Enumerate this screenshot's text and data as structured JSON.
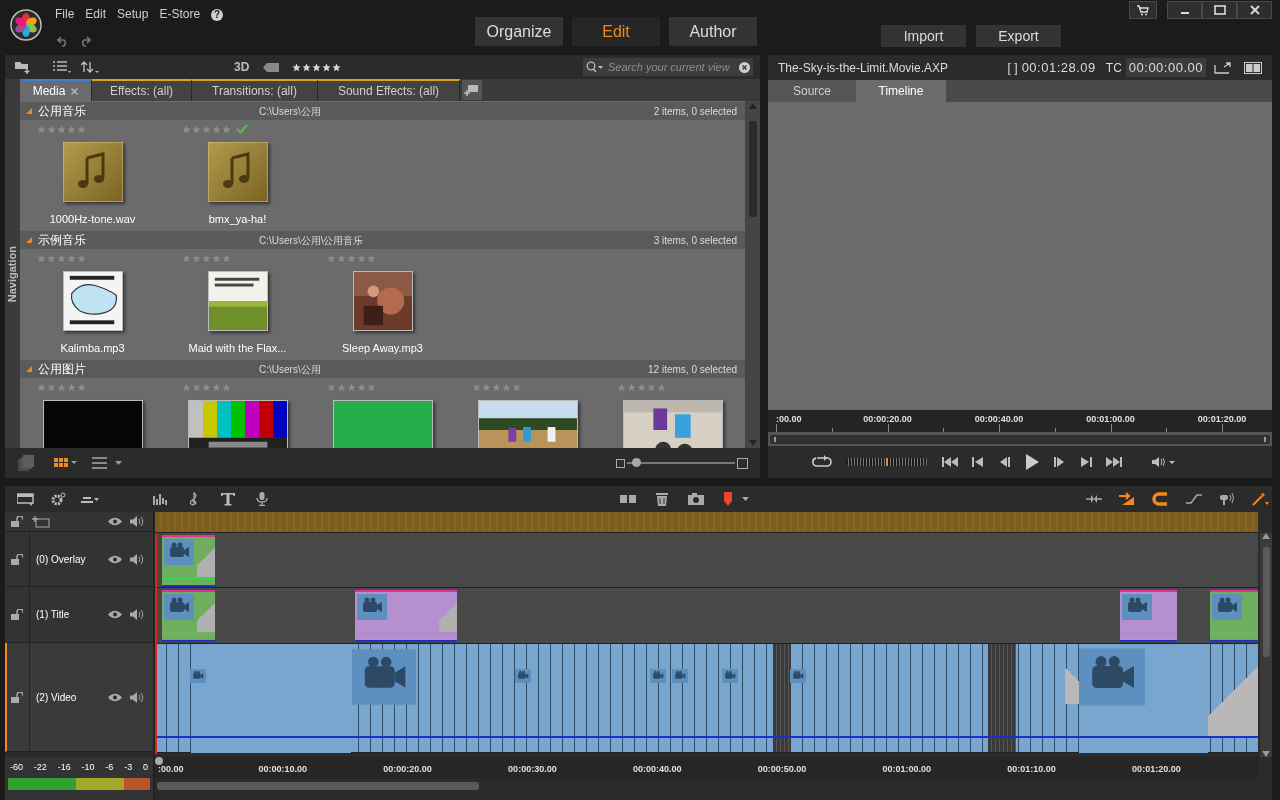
{
  "menu": [
    "File",
    "Edit",
    "Setup",
    "E-Store"
  ],
  "help": "?",
  "modes": [
    {
      "label": "Organize",
      "selected": false
    },
    {
      "label": "Edit",
      "selected": true
    },
    {
      "label": "Author",
      "selected": false
    }
  ],
  "actions": [
    "Import",
    "Export"
  ],
  "library": {
    "view_label": "3D",
    "stars": 5,
    "search": {
      "placeholder": "Search your current view"
    },
    "tabs": [
      {
        "label": "Media",
        "selected": true,
        "closable": true
      },
      {
        "label": "Effects: (all)",
        "selected": false,
        "closable": false
      },
      {
        "label": "Transitions: (all)",
        "selected": false,
        "closable": false
      },
      {
        "label": "Sound Effects: (all)",
        "selected": false,
        "closable": false
      }
    ],
    "navigation_label": "Navigation",
    "zoom": {
      "level": 0.05
    },
    "groups": [
      {
        "title": "公用音乐",
        "path": "C:\\Users\\公用",
        "count": "2 items, 0 selected",
        "items": [
          {
            "name": "1000Hz-tone.wav",
            "kind": "audio",
            "stars": 0,
            "checked": false
          },
          {
            "name": "bmx_ya-ha!",
            "kind": "audio",
            "stars": 0,
            "checked": true
          }
        ]
      },
      {
        "title": "示例音乐",
        "path": "C:\\Users\\公用\\公用音乐",
        "count": "3 items, 0 selected",
        "items": [
          {
            "name": "Kalimba.mp3",
            "kind": "picture",
            "stars": 0,
            "checked": false
          },
          {
            "name": "Maid with the Flax...",
            "kind": "picture",
            "stars": 0,
            "checked": false
          },
          {
            "name": "Sleep Away.mp3",
            "kind": "picture",
            "stars": 0,
            "checked": false
          }
        ]
      },
      {
        "title": "公用图片",
        "path": "C:\\Users\\公用",
        "count": "12 items, 0 selected",
        "items": [
          {
            "kind": "picture",
            "stars": 0,
            "checked": false
          },
          {
            "kind": "picture",
            "stars": 0,
            "checked": false
          },
          {
            "kind": "picture",
            "stars": 0,
            "checked": false
          },
          {
            "kind": "picture",
            "stars": 0,
            "checked": false
          },
          {
            "kind": "picture",
            "stars": 0,
            "checked": false
          }
        ]
      }
    ]
  },
  "player": {
    "title": "The-Sky-is-the-Limit.Movie.AXP",
    "in_out": "[ ]",
    "duration": "00:01:28.09",
    "tc_label": "TC",
    "timecode": "00:00:00.00",
    "tabs": [
      {
        "label": "Source",
        "selected": false
      },
      {
        "label": "Timeline",
        "selected": true
      }
    ],
    "ruler": [
      ":00.00",
      "00:00:20.00",
      "00:00:40.00",
      "00:01:00.00",
      "00:01:20.00"
    ]
  },
  "timeline": {
    "tracks": [
      {
        "name": "(0) Overlay",
        "selected": false
      },
      {
        "name": "(1) Title",
        "selected": false
      },
      {
        "name": "(2) Video",
        "selected": true
      }
    ],
    "ruler": [
      ":00.00",
      "00:00:10.00",
      "00:00:20.00",
      "00:00:30.00",
      "00:00:40.00",
      "00:00:50.00",
      "00:01:00.00",
      "00:01:10.00",
      "00:01:20.00"
    ],
    "meter_labels": [
      "-60",
      "-22",
      "-16",
      "-10",
      "-6",
      "-3",
      "0"
    ]
  }
}
